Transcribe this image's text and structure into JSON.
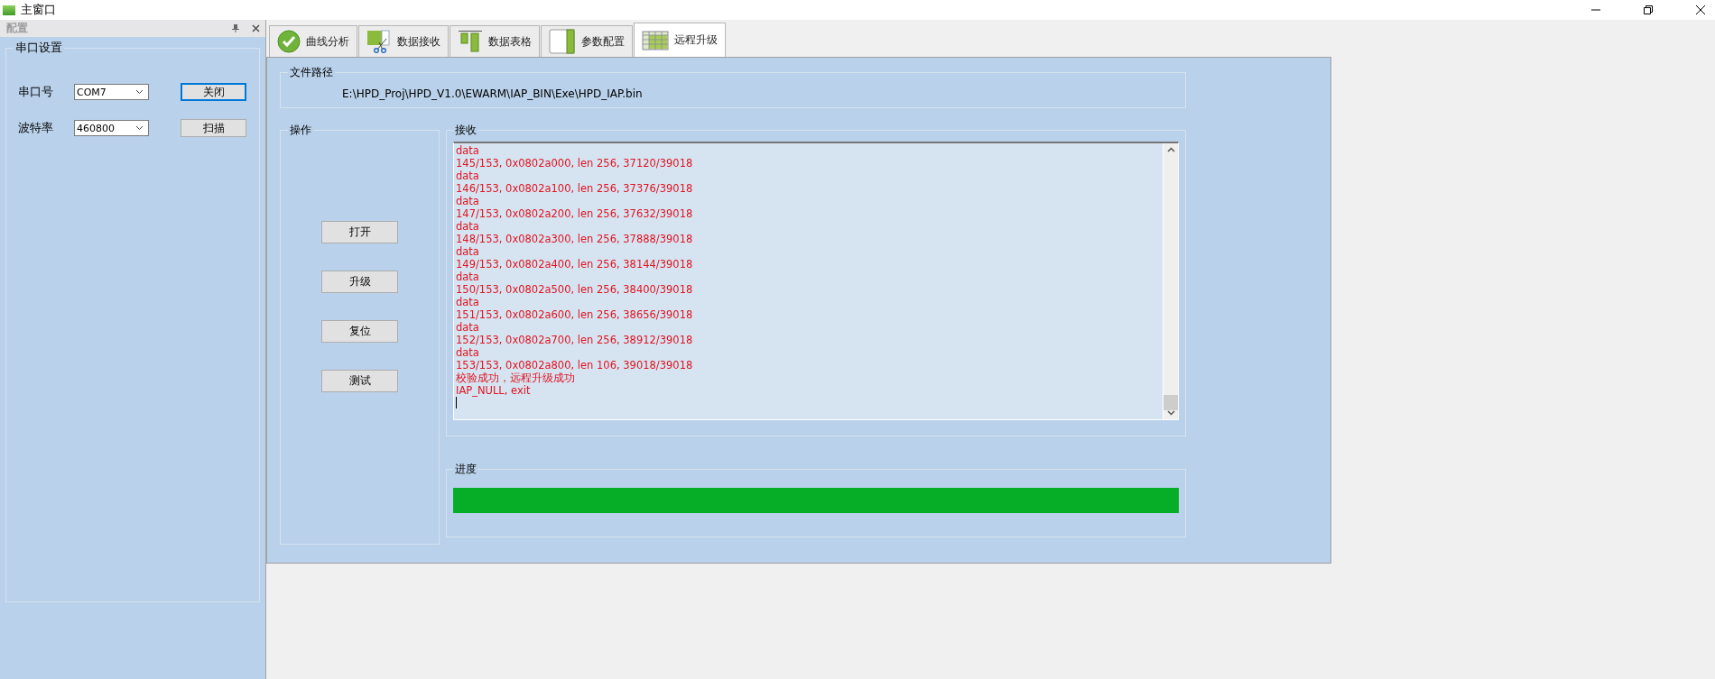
{
  "window": {
    "title": "主窗口"
  },
  "dock_panel": {
    "title": "配置",
    "group": {
      "title": "串口设置",
      "rows": [
        {
          "label": "串口号",
          "value": "COM7",
          "button": "关闭",
          "focused": true
        },
        {
          "label": "波特率",
          "value": "460800",
          "button": "扫描",
          "focused": false
        }
      ]
    }
  },
  "tabs": [
    {
      "label": "曲线分析",
      "kind": "check",
      "selected": false
    },
    {
      "label": "数据接收",
      "kind": "scissors",
      "selected": false
    },
    {
      "label": "数据表格",
      "kind": "columns",
      "selected": false
    },
    {
      "label": "参数配置",
      "kind": "panel",
      "selected": false
    },
    {
      "label": "远程升级",
      "kind": "grid",
      "selected": true
    }
  ],
  "file_path": {
    "title": "文件路径",
    "path": "E:\\HPD_Proj\\HPD_V1.0\\EWARM\\IAP_BIN\\Exe\\HPD_IAP.bin"
  },
  "operations": {
    "title": "操作",
    "buttons": [
      "打开",
      "升级",
      "复位",
      "测试"
    ]
  },
  "receive": {
    "title": "接收",
    "lines": [
      "data",
      "145/153, 0x0802a000, len 256, 37120/39018",
      "data",
      "146/153, 0x0802a100, len 256, 37376/39018",
      "data",
      "147/153, 0x0802a200, len 256, 37632/39018",
      "data",
      "148/153, 0x0802a300, len 256, 37888/39018",
      "data",
      "149/153, 0x0802a400, len 256, 38144/39018",
      "data",
      "150/153, 0x0802a500, len 256, 38400/39018",
      "data",
      "151/153, 0x0802a600, len 256, 38656/39018",
      "data",
      "152/153, 0x0802a700, len 256, 38912/39018",
      "data",
      "153/153, 0x0802a800, len 106, 39018/39018",
      "校验成功，远程升级成功",
      "IAP_NULL, exit"
    ]
  },
  "progress": {
    "title": "进度",
    "level": 1
  }
}
